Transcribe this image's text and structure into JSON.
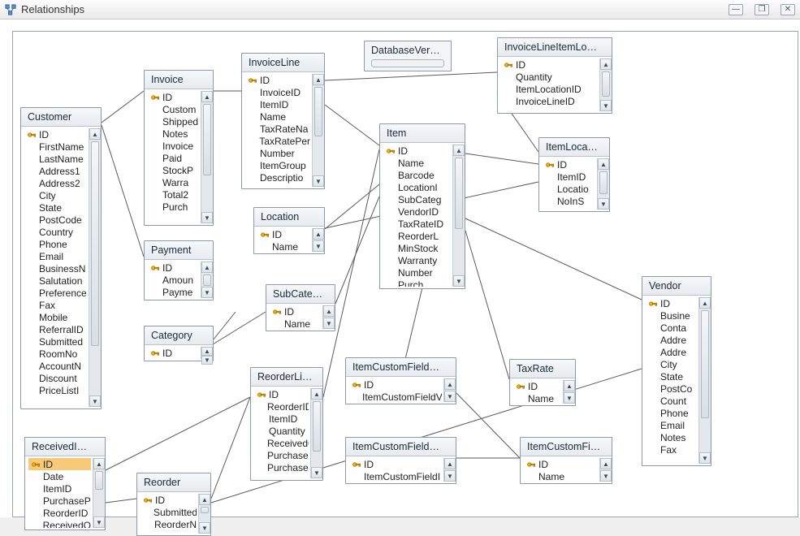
{
  "window": {
    "title": "Relationships",
    "min": "—",
    "max": "❐",
    "close": "✕"
  },
  "dbver": {
    "title": "DatabaseVer…"
  },
  "tables": {
    "customer": {
      "title": "Customer",
      "fields": [
        "ID",
        "FirstName",
        "LastName",
        "Address1",
        "Address2",
        "City",
        "State",
        "PostCode",
        "Country",
        "Phone",
        "Email",
        "BusinessN",
        "Salutation",
        "Preference",
        "Fax",
        "Mobile",
        "ReferralID",
        "Submitted",
        "RoomNo",
        "AccountN",
        "Discount",
        "PriceListI"
      ]
    },
    "receivedItem": {
      "title": "ReceivedI…",
      "selected": 0,
      "fields": [
        "ID",
        "Date",
        "ItemID",
        "PurchaseP",
        "ReorderID",
        "ReceivedQ"
      ]
    },
    "invoice": {
      "title": "Invoice",
      "fields": [
        "ID",
        "Custom",
        "Shipped",
        "Notes",
        "Invoice",
        "Paid",
        "StockP",
        "Warra",
        "Total2",
        "Purch"
      ]
    },
    "payment": {
      "title": "Payment",
      "fields": [
        "ID",
        "Amoun",
        "Payme"
      ]
    },
    "category": {
      "title": "Category",
      "fields": [
        "ID"
      ]
    },
    "reorder": {
      "title": "Reorder",
      "fields": [
        "ID",
        "Submitted",
        "ReorderN"
      ]
    },
    "invoiceLine": {
      "title": "InvoiceLine",
      "fields": [
        "ID",
        "InvoiceID",
        "ItemID",
        "Name",
        "TaxRateNa",
        "TaxRatePer",
        "Number",
        "ItemGroup",
        "Descriptio"
      ]
    },
    "location": {
      "title": "Location",
      "fields": [
        "ID",
        "Name"
      ]
    },
    "subCategory": {
      "title": "SubCateg…",
      "fields": [
        "ID",
        "Name"
      ]
    },
    "reorderLine": {
      "title": "ReorderLi…",
      "fields": [
        "ID",
        "ReorderID",
        "ItemID",
        "Quantity",
        "ReceivedQ",
        "PurchaseP",
        "PurchaseT"
      ]
    },
    "item": {
      "title": "Item",
      "fields": [
        "ID",
        "Name",
        "Barcode",
        "LocationI",
        "SubCateg",
        "VendorID",
        "TaxRateID",
        "ReorderL",
        "MinStock",
        "Warranty",
        "Number",
        "Purch"
      ]
    },
    "itemCustomFieldValue": {
      "title": "ItemCustomField…",
      "fields": [
        "ID",
        "ItemCustomFieldV"
      ]
    },
    "itemCustomFieldId": {
      "title": "ItemCustomField…",
      "fields": [
        "ID",
        "ItemCustomFieldI"
      ]
    },
    "invoiceLineItemLo": {
      "title": "InvoiceLineItemLo…",
      "fields": [
        "ID",
        "Quantity",
        "ItemLocationID",
        "InvoiceLineID"
      ]
    },
    "itemLocation": {
      "title": "ItemLoca…",
      "fields": [
        "ID",
        "ItemID",
        "Locatio",
        "NoInS"
      ]
    },
    "taxRate": {
      "title": "TaxRate",
      "fields": [
        "ID",
        "Name"
      ]
    },
    "itemCustomField": {
      "title": "ItemCustomFi…",
      "fields": [
        "ID",
        "Name"
      ]
    },
    "vendor": {
      "title": "Vendor",
      "fields": [
        "ID",
        "Busine",
        "Conta",
        "Addre",
        "Addre",
        "City",
        "State",
        "PostCo",
        "Count",
        "Phone",
        "Email",
        "Notes",
        "Fax"
      ]
    }
  },
  "chart_data": {
    "type": "table",
    "title": "Relationships (database ER diagram)",
    "entities": [
      {
        "name": "Customer",
        "pk": [
          "ID"
        ],
        "fields": [
          "ID",
          "FirstName",
          "LastName",
          "Address1",
          "Address2",
          "City",
          "State",
          "PostCode",
          "Country",
          "Phone",
          "Email",
          "BusinessName",
          "Salutation",
          "Preference",
          "Fax",
          "Mobile",
          "ReferralID",
          "Submitted",
          "RoomNo",
          "AccountN",
          "Discount",
          "PriceListID"
        ]
      },
      {
        "name": "Invoice",
        "pk": [
          "ID"
        ],
        "fields": [
          "ID",
          "CustomerID",
          "Shipped",
          "Notes",
          "InvoiceNo",
          "Paid",
          "StockP",
          "Warranty",
          "Total2",
          "PurchaseOrder"
        ]
      },
      {
        "name": "Payment",
        "pk": [
          "ID"
        ],
        "fields": [
          "ID",
          "Amount",
          "PaymentMethod"
        ]
      },
      {
        "name": "InvoiceLine",
        "pk": [
          "ID"
        ],
        "fields": [
          "ID",
          "InvoiceID",
          "ItemID",
          "Name",
          "TaxRateName",
          "TaxRatePercent",
          "Number",
          "ItemGroup",
          "Description"
        ]
      },
      {
        "name": "Location",
        "pk": [
          "ID"
        ],
        "fields": [
          "ID",
          "Name"
        ]
      },
      {
        "name": "SubCategory",
        "pk": [
          "ID"
        ],
        "fields": [
          "ID",
          "Name"
        ]
      },
      {
        "name": "Category",
        "pk": [
          "ID"
        ],
        "fields": [
          "ID"
        ]
      },
      {
        "name": "ReorderLine",
        "pk": [
          "ID"
        ],
        "fields": [
          "ID",
          "ReorderID",
          "ItemID",
          "Quantity",
          "ReceivedQty",
          "PurchasePrice",
          "PurchaseTotal"
        ]
      },
      {
        "name": "Reorder",
        "pk": [
          "ID"
        ],
        "fields": [
          "ID",
          "Submitted",
          "ReorderNo"
        ]
      },
      {
        "name": "ReceivedItem",
        "pk": [
          "ID"
        ],
        "fields": [
          "ID",
          "Date",
          "ItemID",
          "PurchasePrice",
          "ReorderID",
          "ReceivedQty"
        ]
      },
      {
        "name": "Item",
        "pk": [
          "ID"
        ],
        "fields": [
          "ID",
          "Name",
          "Barcode",
          "LocationID",
          "SubCategoryID",
          "VendorID",
          "TaxRateID",
          "ReorderLevel",
          "MinStock",
          "Warranty",
          "Number",
          "Purchase"
        ]
      },
      {
        "name": "ItemLocation",
        "pk": [
          "ID"
        ],
        "fields": [
          "ID",
          "ItemID",
          "LocationID",
          "NoInStock"
        ]
      },
      {
        "name": "InvoiceLineItemLocation",
        "pk": [
          "ID"
        ],
        "fields": [
          "ID",
          "Quantity",
          "ItemLocationID",
          "InvoiceLineID"
        ]
      },
      {
        "name": "TaxRate",
        "pk": [
          "ID"
        ],
        "fields": [
          "ID",
          "Name"
        ]
      },
      {
        "name": "ItemCustomFieldValue",
        "pk": [
          "ID"
        ],
        "fields": [
          "ID",
          "ItemCustomFieldValue"
        ]
      },
      {
        "name": "ItemCustomFieldId",
        "pk": [
          "ID"
        ],
        "fields": [
          "ID",
          "ItemCustomFieldId"
        ]
      },
      {
        "name": "ItemCustomField",
        "pk": [
          "ID"
        ],
        "fields": [
          "ID",
          "Name"
        ]
      },
      {
        "name": "Vendor",
        "pk": [
          "ID"
        ],
        "fields": [
          "ID",
          "BusinessName",
          "Contact",
          "Address1",
          "Address2",
          "City",
          "State",
          "PostCode",
          "Country",
          "Phone",
          "Email",
          "Notes",
          "Fax"
        ]
      },
      {
        "name": "DatabaseVersion",
        "pk": [],
        "fields": []
      }
    ],
    "relationships": [
      {
        "from": "Customer.ID",
        "to": "Invoice.CustomerID"
      },
      {
        "from": "Customer.ID",
        "to": "Payment"
      },
      {
        "from": "Invoice.ID",
        "to": "InvoiceLine.InvoiceID"
      },
      {
        "from": "InvoiceLine.ItemID",
        "to": "Item.ID"
      },
      {
        "from": "InvoiceLine.ID",
        "to": "InvoiceLineItemLocation.InvoiceLineID"
      },
      {
        "from": "InvoiceLineItemLocation.ItemLocationID",
        "to": "ItemLocation.ID"
      },
      {
        "from": "Item.LocationID",
        "to": "Location.ID"
      },
      {
        "from": "Item.ID",
        "to": "ItemLocation.ItemID"
      },
      {
        "from": "Item.SubCategoryID",
        "to": "SubCategory.ID"
      },
      {
        "from": "SubCategory",
        "to": "Category.ID"
      },
      {
        "from": "Item.TaxRateID",
        "to": "TaxRate.ID"
      },
      {
        "from": "Item.VendorID",
        "to": "Vendor.ID"
      },
      {
        "from": "Item.ID",
        "to": "ItemCustomFieldValue"
      },
      {
        "from": "Item.ID",
        "to": "ReorderLine.ItemID"
      },
      {
        "from": "ReorderLine.ReorderID",
        "to": "Reorder.ID"
      },
      {
        "from": "Reorder",
        "to": "Vendor"
      },
      {
        "from": "ReceivedItem.ReorderID",
        "to": "Reorder.ID"
      },
      {
        "from": "ReceivedItem.ItemID",
        "to": "ReorderLine"
      },
      {
        "from": "ItemCustomFieldValue",
        "to": "ItemCustomField.ID"
      },
      {
        "from": "ItemCustomFieldId",
        "to": "ItemCustomField.ID"
      },
      {
        "from": "ItemLocation.LocationID",
        "to": "Location.ID"
      }
    ]
  }
}
